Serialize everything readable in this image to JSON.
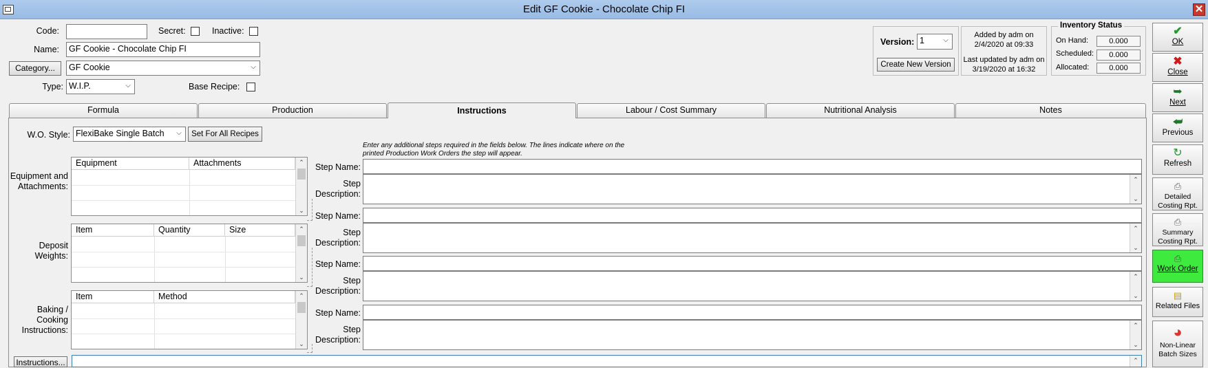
{
  "window": {
    "title": "Edit GF Cookie - Chocolate Chip FI",
    "close_glyph": "✕"
  },
  "header": {
    "code_label": "Code:",
    "code_value": "",
    "secret_label": "Secret:",
    "inactive_label": "Inactive:",
    "name_label": "Name:",
    "name_value": "GF Cookie - Chocolate Chip FI",
    "category_button": "Category...",
    "category_value": "GF Cookie",
    "type_label": "Type:",
    "type_value": "W.I.P.",
    "base_recipe_label": "Base Recipe:"
  },
  "version": {
    "label": "Version:",
    "value": "1",
    "create_button": "Create New Version"
  },
  "audit": {
    "added_line1": "Added by adm on",
    "added_line2": "2/4/2020 at 09:33",
    "updated_line1": "Last updated by adm on",
    "updated_line2": "3/19/2020 at 16:32"
  },
  "inventory": {
    "title": "Inventory Status",
    "rows": [
      {
        "label": "On Hand:",
        "value": "0.000"
      },
      {
        "label": "Scheduled:",
        "value": "0.000"
      },
      {
        "label": "Allocated:",
        "value": "0.000"
      }
    ]
  },
  "tabs": [
    "Formula",
    "Production",
    "Instructions",
    "Labour / Cost Summary",
    "Nutritional Analysis",
    "Notes"
  ],
  "active_tab": "Instructions",
  "instructions": {
    "wo_style_label": "W.O. Style:",
    "wo_style_value": "FlexiBake Single Batch",
    "set_all_button": "Set For All Recipes",
    "note": "Enter any additional steps required in the fields below.  The lines indicate where on the printed Production Work Orders the step will appear.",
    "equipment": {
      "label": "Equipment and Attachments:",
      "columns": [
        "Equipment",
        "Attachments"
      ]
    },
    "deposit": {
      "label": "Deposit Weights:",
      "columns": [
        "Item",
        "Quantity",
        "Size"
      ]
    },
    "baking": {
      "label": "Baking / Cooking Instructions:",
      "columns": [
        "Item",
        "Method"
      ]
    },
    "step_name_label": "Step Name:",
    "step_desc_label": "Step Description:",
    "instructions_button": "Instructions..."
  },
  "sidebar": [
    {
      "label": "OK",
      "icon": "check-icon"
    },
    {
      "label": "Close",
      "icon": "x-icon"
    },
    {
      "label": "Next",
      "icon": "next-icon"
    },
    {
      "label": "Previous",
      "icon": "previous-icon"
    },
    {
      "label": "Refresh",
      "icon": "refresh-icon"
    },
    {
      "label": "Detailed Costing Rpt.",
      "icon": "printer-icon"
    },
    {
      "label": "Summary Costing Rpt.",
      "icon": "printer-icon"
    },
    {
      "label": "Work Order",
      "icon": "printer-icon"
    },
    {
      "label": "Related Files",
      "icon": "folder-icon"
    },
    {
      "label": "Non-Linear Batch Sizes",
      "icon": "pie-chart-icon"
    }
  ],
  "colors": {
    "titlebar": "#a9c7ea",
    "work_order_bg": "#3dea3d",
    "close_red": "#c9382c"
  }
}
